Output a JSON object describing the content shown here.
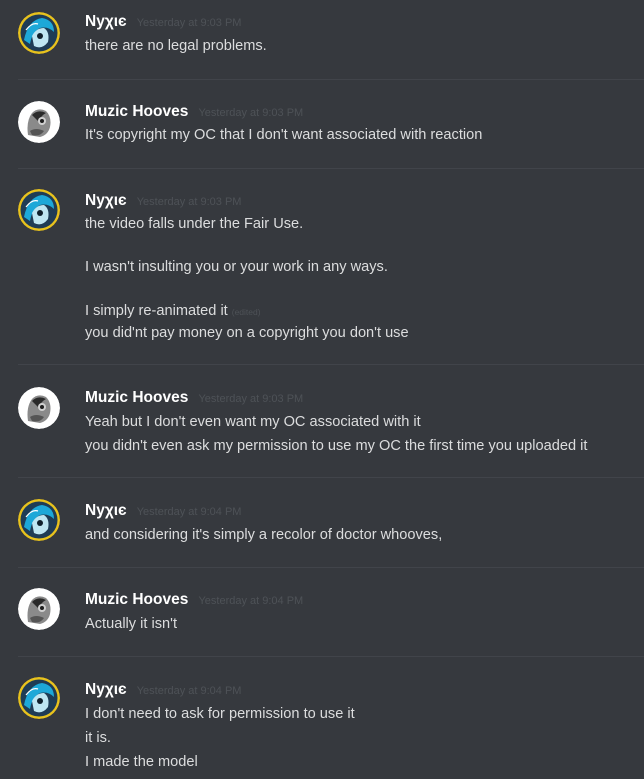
{
  "colors": {
    "background": "#36393e",
    "text": "#dcddde",
    "username": "#ffffff",
    "timestamp": "#4e5257",
    "divider": "#41444a"
  },
  "messages": [
    {
      "username": "Nyχιє",
      "timestamp": "Yesterday at 9:03 PM",
      "avatar": "nyxie-avatar",
      "lines": [
        "there are no legal problems."
      ]
    },
    {
      "username": "Muzic Hooves",
      "timestamp": "Yesterday at 9:03 PM",
      "avatar": "muzic-hooves-avatar",
      "lines": [
        "It's copyright my OC that I don't want associated with reaction"
      ]
    },
    {
      "username": "Nyχιє",
      "timestamp": "Yesterday at 9:03 PM",
      "avatar": "nyxie-avatar",
      "lines": [
        "the video falls under the Fair Use.",
        "I wasn't insulting you or your work in any ways.",
        "I simply re-animated it",
        "you did'nt pay money on a copyright you don't use"
      ],
      "edited_label": "(edited)"
    },
    {
      "username": "Muzic Hooves",
      "timestamp": "Yesterday at 9:03 PM",
      "avatar": "muzic-hooves-avatar",
      "lines": [
        "Yeah but I don't even want my OC associated with it",
        "you didn't even ask my permission to use my OC the first time you uploaded it"
      ]
    },
    {
      "username": "Nyχιє",
      "timestamp": "Yesterday at 9:04 PM",
      "avatar": "nyxie-avatar",
      "lines": [
        "and considering it's simply a recolor of doctor whooves,"
      ]
    },
    {
      "username": "Muzic Hooves",
      "timestamp": "Yesterday at 9:04 PM",
      "avatar": "muzic-hooves-avatar",
      "lines": [
        "Actually it isn't"
      ]
    },
    {
      "username": "Nyχιє",
      "timestamp": "Yesterday at 9:04 PM",
      "avatar": "nyxie-avatar",
      "lines": [
        "I don't need to ask for permission to use it",
        "it is.",
        "I made the model"
      ]
    }
  ]
}
